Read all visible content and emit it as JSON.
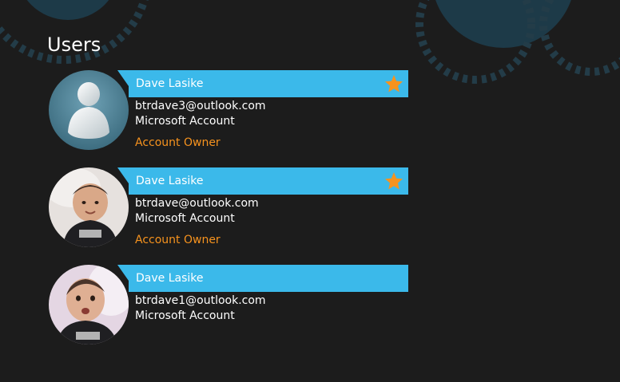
{
  "page": {
    "title": "Users"
  },
  "colors": {
    "background": "#1c1c1c",
    "banner": "#3bb9ea",
    "owner_label": "#f7931e",
    "star": "#f7931e"
  },
  "users": [
    {
      "name": "Dave Lasike",
      "email": "btrdave3@outlook.com",
      "account_type": "Microsoft Account",
      "role": "Account Owner",
      "starred": true,
      "avatar": "default-user-avatar"
    },
    {
      "name": "Dave Lasike",
      "email": "btrdave@outlook.com",
      "account_type": "Microsoft Account",
      "role": "Account Owner",
      "starred": true,
      "avatar": "baby-photo-avatar"
    },
    {
      "name": "Dave Lasike",
      "email": "btrdave1@outlook.com",
      "account_type": "Microsoft Account",
      "role": "",
      "starred": false,
      "avatar": "baby-photo-avatar"
    }
  ]
}
